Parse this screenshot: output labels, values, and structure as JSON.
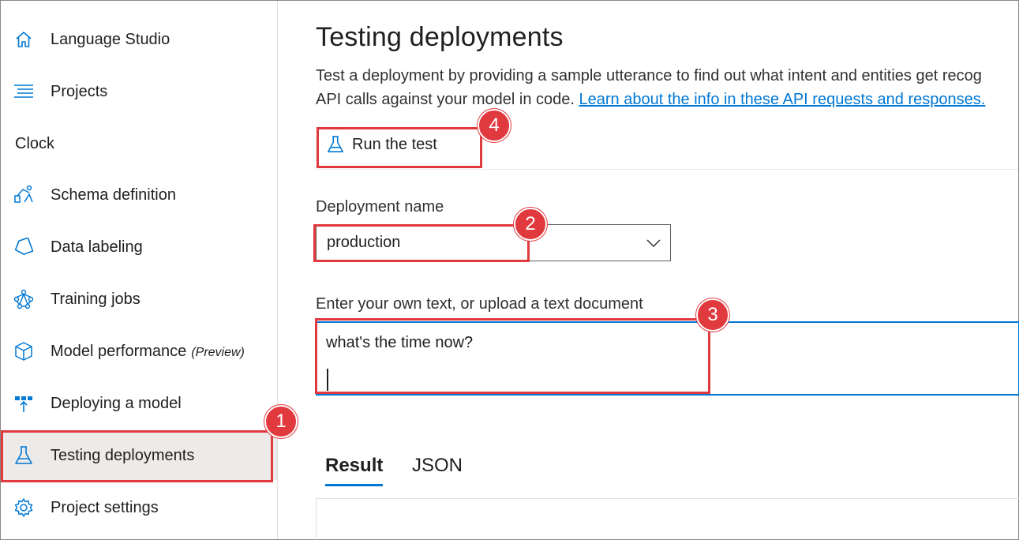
{
  "sidebar": {
    "top_items": [
      {
        "label": "Language Studio",
        "icon": "home-icon"
      },
      {
        "label": "Projects",
        "icon": "list-icon"
      }
    ],
    "group_label": "Clock",
    "items": [
      {
        "label": "Schema definition",
        "icon": "schema-icon"
      },
      {
        "label": "Data labeling",
        "icon": "tag-icon"
      },
      {
        "label": "Training jobs",
        "icon": "network-icon"
      },
      {
        "label": "Model performance",
        "suffix": "(Preview)",
        "icon": "cube-icon"
      },
      {
        "label": "Deploying a model",
        "icon": "deploy-icon"
      },
      {
        "label": "Testing deployments",
        "icon": "flask-icon",
        "selected": true
      },
      {
        "label": "Project settings",
        "icon": "gear-icon"
      }
    ]
  },
  "main": {
    "title": "Testing deployments",
    "description_line1": "Test a deployment by providing a sample utterance to find out what intent and entities get recog",
    "description_line2": "API calls against your model in code.",
    "description_link": "Learn about the info in these API requests and responses.",
    "run_test_label": "Run the test",
    "deployment_label": "Deployment name",
    "deployment_value": "production",
    "text_label": "Enter your own text, or upload a text document",
    "text_value": "what's the time now?",
    "tabs": [
      {
        "label": "Result",
        "active": true
      },
      {
        "label": "JSON",
        "active": false
      }
    ]
  },
  "annotations": {
    "badges": [
      "1",
      "2",
      "3",
      "4"
    ],
    "color": "#e0393e"
  },
  "colors": {
    "accent": "#0078d4",
    "selected_bg": "#edebe9",
    "annotation": "#e0393e"
  }
}
